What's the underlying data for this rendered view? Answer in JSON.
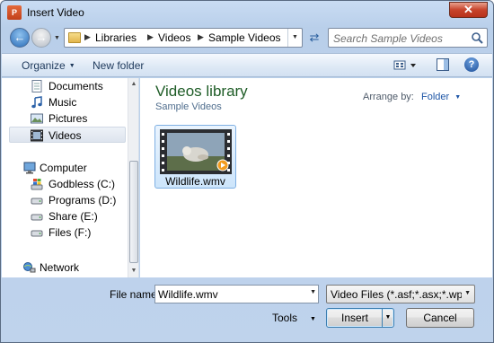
{
  "window": {
    "title": "Insert Video",
    "app_icon_text": "P",
    "close_symbol": "✕"
  },
  "address": {
    "breadcrumbs": [
      "Libraries",
      "Videos",
      "Sample Videos"
    ],
    "separator": "▶",
    "dropdown_symbol": "▼"
  },
  "search": {
    "placeholder": "Search Sample Videos"
  },
  "toolbar": {
    "organize_label": "Organize",
    "new_folder_label": "New folder",
    "help_symbol": "?"
  },
  "nav": {
    "items": [
      {
        "label": "Documents",
        "icon": "documents-icon"
      },
      {
        "label": "Music",
        "icon": "music-icon"
      },
      {
        "label": "Pictures",
        "icon": "pictures-icon"
      },
      {
        "label": "Videos",
        "icon": "videos-icon",
        "selected": true
      },
      {
        "label": "Computer",
        "icon": "computer-icon"
      },
      {
        "label": "Godbless (C:)",
        "icon": "windows-drive-icon"
      },
      {
        "label": "Programs (D:)",
        "icon": "drive-icon"
      },
      {
        "label": "Share (E:)",
        "icon": "drive-icon"
      },
      {
        "label": "Files (F:)",
        "icon": "drive-icon"
      },
      {
        "label": "Network",
        "icon": "network-icon"
      }
    ]
  },
  "content": {
    "library_title": "Videos library",
    "library_subtitle": "Sample Videos",
    "arrange_label": "Arrange by:",
    "arrange_value": "Folder",
    "files": [
      {
        "name": "Wildlife.wmv",
        "icon": "video-thumbnail-icon",
        "selected": true
      }
    ]
  },
  "footer": {
    "file_name_label": "File name:",
    "file_name_value": "Wildlife.wmv",
    "file_type_value": "Video Files (*.asf;*.asx;*.wpl;*.wm",
    "tools_label": "Tools",
    "insert_label": "Insert",
    "cancel_label": "Cancel"
  },
  "colors": {
    "library_title": "#1e5c26",
    "link_blue": "#1d55a6",
    "selection": "#cde5fb"
  }
}
